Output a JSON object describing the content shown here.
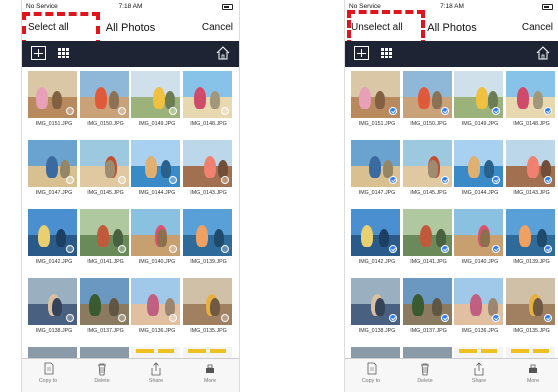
{
  "status": {
    "carrier": "No Service",
    "time": "7:18 AM"
  },
  "screens": [
    {
      "left_button": "Select all",
      "title": "All Photos",
      "right_button": "Cancel",
      "all_selected": false
    },
    {
      "left_button": "Unselect all",
      "title": "All Photos",
      "right_button": "Cancel",
      "all_selected": true
    }
  ],
  "photos": [
    "IMG_0151.JPG",
    "IMG_0150.JPG",
    "IMG_0149.JPG",
    "IMG_0148.JPG",
    "IMG_0147.JPG",
    "IMG_0145.JPG",
    "IMG_0144.JPG",
    "IMG_0143.JPG",
    "IMG_0142.JPG",
    "IMG_0141.JPG",
    "IMG_0140.JPG",
    "IMG_0139.JPG",
    "IMG_0138.JPG",
    "IMG_0137.JPG",
    "IMG_0136.JPG",
    "IMG_0135.JPG"
  ],
  "bottom_bar": [
    {
      "label": "Copy to",
      "icon": "copy-icon"
    },
    {
      "label": "Delete",
      "icon": "trash-icon"
    },
    {
      "label": "Share",
      "icon": "share-icon"
    },
    {
      "label": "More",
      "icon": "more-icon"
    }
  ],
  "colors": {
    "toolbar": "#1e2433",
    "highlight": "#e0141d",
    "check_selected": "#2f7cf6"
  }
}
